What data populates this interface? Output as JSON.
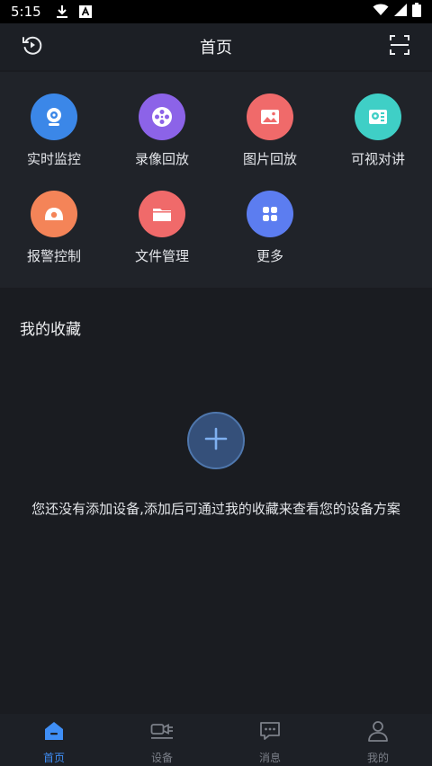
{
  "status_bar": {
    "time": "5:15",
    "icons": [
      "download-icon",
      "a-badge-icon",
      "wifi-icon",
      "signal-icon",
      "battery-icon"
    ]
  },
  "header": {
    "title": "首页",
    "left_icon": "history-icon",
    "right_icon": "scan-icon"
  },
  "features": [
    {
      "label": "实时监控",
      "icon": "camera-icon",
      "color": "#3b87e8"
    },
    {
      "label": "录像回放",
      "icon": "film-reel-icon",
      "color": "#8c63e8"
    },
    {
      "label": "图片回放",
      "icon": "image-icon",
      "color": "#f06a6a"
    },
    {
      "label": "可视对讲",
      "icon": "intercom-icon",
      "color": "#3fcfc6"
    },
    {
      "label": "报警控制",
      "icon": "alarm-icon",
      "color": "#f48458"
    },
    {
      "label": "文件管理",
      "icon": "folder-icon",
      "color": "#f06a6a"
    },
    {
      "label": "更多",
      "icon": "more-apps-icon",
      "color": "#5c7df0"
    }
  ],
  "favorites": {
    "title": "我的收藏",
    "add_icon": "plus-icon",
    "empty_message": "您还没有添加设备,添加后可通过我的收藏来查看您的设备方案"
  },
  "bottom_nav": [
    {
      "label": "首页",
      "icon": "home-icon",
      "active": true
    },
    {
      "label": "设备",
      "icon": "device-icon",
      "active": false
    },
    {
      "label": "消息",
      "icon": "message-icon",
      "active": false
    },
    {
      "label": "我的",
      "icon": "user-icon",
      "active": false
    }
  ],
  "colors": {
    "background": "#1a1c21",
    "panel": "#202329",
    "accent": "#3f8ef5",
    "add_button_fill": "#35507a"
  }
}
